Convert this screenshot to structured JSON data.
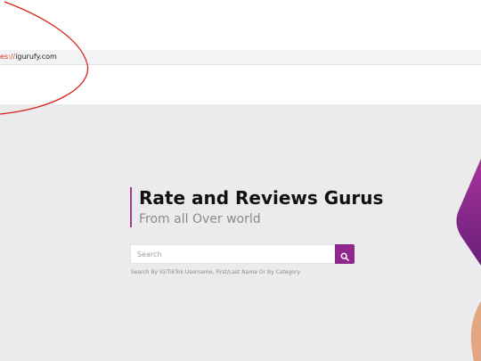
{
  "browser": {
    "url_scheme": "es://",
    "url_host": "igurufy.com"
  },
  "hero": {
    "title": "Rate and Reviews Gurus",
    "subtitle": "From all Over world",
    "search": {
      "placeholder": "Search",
      "value": "",
      "button_icon": "search-icon"
    },
    "hint": "Search By IG/TikTok Username, First/Last Name Or By Category"
  },
  "colors": {
    "accent": "#8f278d",
    "hero_bg": "#ebebed",
    "title": "#111111",
    "subtitle": "#8a8a8a",
    "annotation": "#d9231d"
  }
}
